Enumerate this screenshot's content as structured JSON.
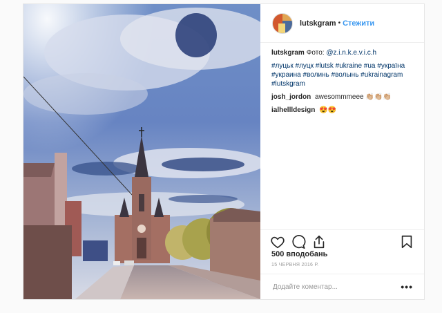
{
  "post": {
    "username": "lutskgram",
    "follow_label": "Стежити",
    "separator": "•"
  },
  "caption": {
    "username": "lutskgram",
    "text": "Фото: ",
    "mention": "@z.i.n.k.e.v.i.c.h",
    "hashtags": "#луцьк #луцк #lutsk #ukraine #ua #україна #украина #волинь #волынь #ukrainagram #lutskgram"
  },
  "comments": [
    {
      "username": "josh_jordon",
      "text": "awesommmeee 👏🏼👏🏼👏🏼"
    },
    {
      "username": "ialhellldesign",
      "text": "😍😍"
    }
  ],
  "likes_label": "500 вподобань",
  "date_label": "15 ЧЕРВНЯ 2016 Р.",
  "comment_input": {
    "placeholder": "Додайте коментар..."
  },
  "more_label": "•••",
  "icons": {
    "like": "heart-icon",
    "comment": "comment-icon",
    "share": "share-icon",
    "save": "bookmark-icon"
  },
  "colors": {
    "link": "#3897f0",
    "hashtag": "#003569",
    "text": "#262626",
    "muted": "#999999",
    "border": "#efefef"
  }
}
